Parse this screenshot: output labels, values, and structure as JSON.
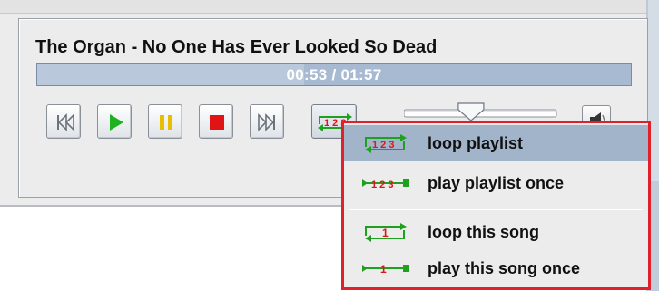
{
  "player": {
    "song_title": "The Organ - No One Has Ever Looked So Dead",
    "elapsed": "00:53",
    "total": "01:57",
    "time_text": "00:53 / 01:57",
    "progress_fraction": 0.45,
    "volume_fraction": 0.44
  },
  "transport": {
    "buttons": [
      {
        "name": "previous-button",
        "icon": "skip-back-icon"
      },
      {
        "name": "play-button",
        "icon": "play-icon"
      },
      {
        "name": "pause-button",
        "icon": "pause-icon"
      },
      {
        "name": "stop-button",
        "icon": "stop-icon"
      },
      {
        "name": "next-button",
        "icon": "skip-forward-icon"
      },
      {
        "name": "play-mode-button",
        "icon": "loop-playlist-icon"
      }
    ],
    "mute_icon": "speaker-icon"
  },
  "play_mode_menu": {
    "items": [
      {
        "label": "loop playlist",
        "icon": "loop-playlist-icon",
        "selected": true
      },
      {
        "label": "play playlist once",
        "icon": "playlist-once-icon",
        "selected": false
      },
      {
        "label": "loop this song",
        "icon": "loop-song-icon",
        "selected": false
      },
      {
        "label": "play this song once",
        "icon": "song-once-icon",
        "selected": false
      }
    ]
  },
  "colors": {
    "play_green": "#1fb11f",
    "pause_yellow": "#e6c000",
    "stop_red": "#e01414",
    "menu_border_red": "#e0212b",
    "selection_blue": "#a2b4ca",
    "progress_blue": "#a8bad1"
  }
}
